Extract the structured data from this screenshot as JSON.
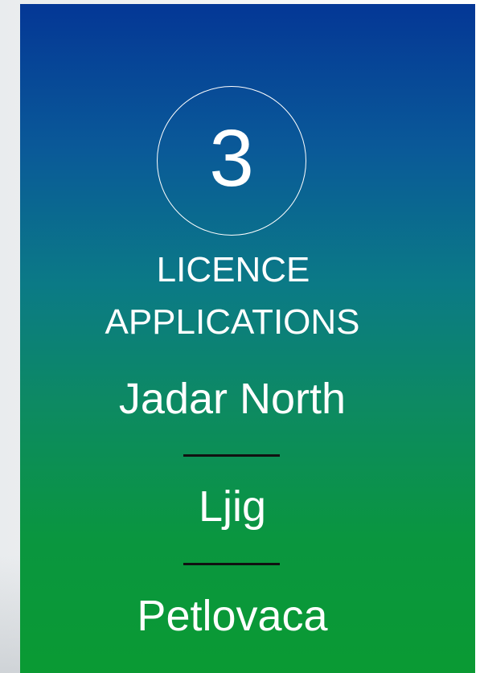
{
  "badge": {
    "number": "3",
    "label_line1": "LICENCE",
    "label_line2": "APPLICATIONS"
  },
  "licences": [
    {
      "name": "Jadar North"
    },
    {
      "name": "Ljig"
    },
    {
      "name": "Petlovaca"
    }
  ],
  "colors": {
    "gradient_top": "#043796",
    "gradient_bottom": "#0a9a33",
    "text": "#ffffff",
    "divider": "#111111"
  }
}
